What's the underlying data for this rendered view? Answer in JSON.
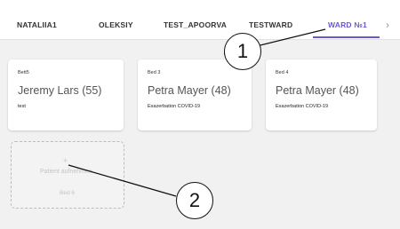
{
  "tabs": [
    {
      "label": "NATALIIA1"
    },
    {
      "label": "OLEKSIY"
    },
    {
      "label": "TEST_APOORVA"
    },
    {
      "label": "TESTWARD"
    },
    {
      "label": "WARD №1"
    }
  ],
  "tabs_next_icon": "chevron-right",
  "beds": [
    {
      "bed": "Bett5",
      "patient": "Jeremy Lars (55)",
      "diagnosis": "test"
    },
    {
      "bed": "Bed 3",
      "patient": "Petra Mayer (48)",
      "diagnosis": "Exazerbation COVID-19"
    },
    {
      "bed": "Bed 4",
      "patient": "Petra Mayer (48)",
      "diagnosis": "Exazerbation COVID-19"
    }
  ],
  "empty_bed": {
    "icon": "add-icon",
    "title": "Patient aufnehmen",
    "bed": "Bed 6"
  },
  "callouts": [
    {
      "number": "1"
    },
    {
      "number": "2"
    }
  ],
  "colors": {
    "accent": "#6a58c9",
    "background": "#f1f1f1"
  }
}
